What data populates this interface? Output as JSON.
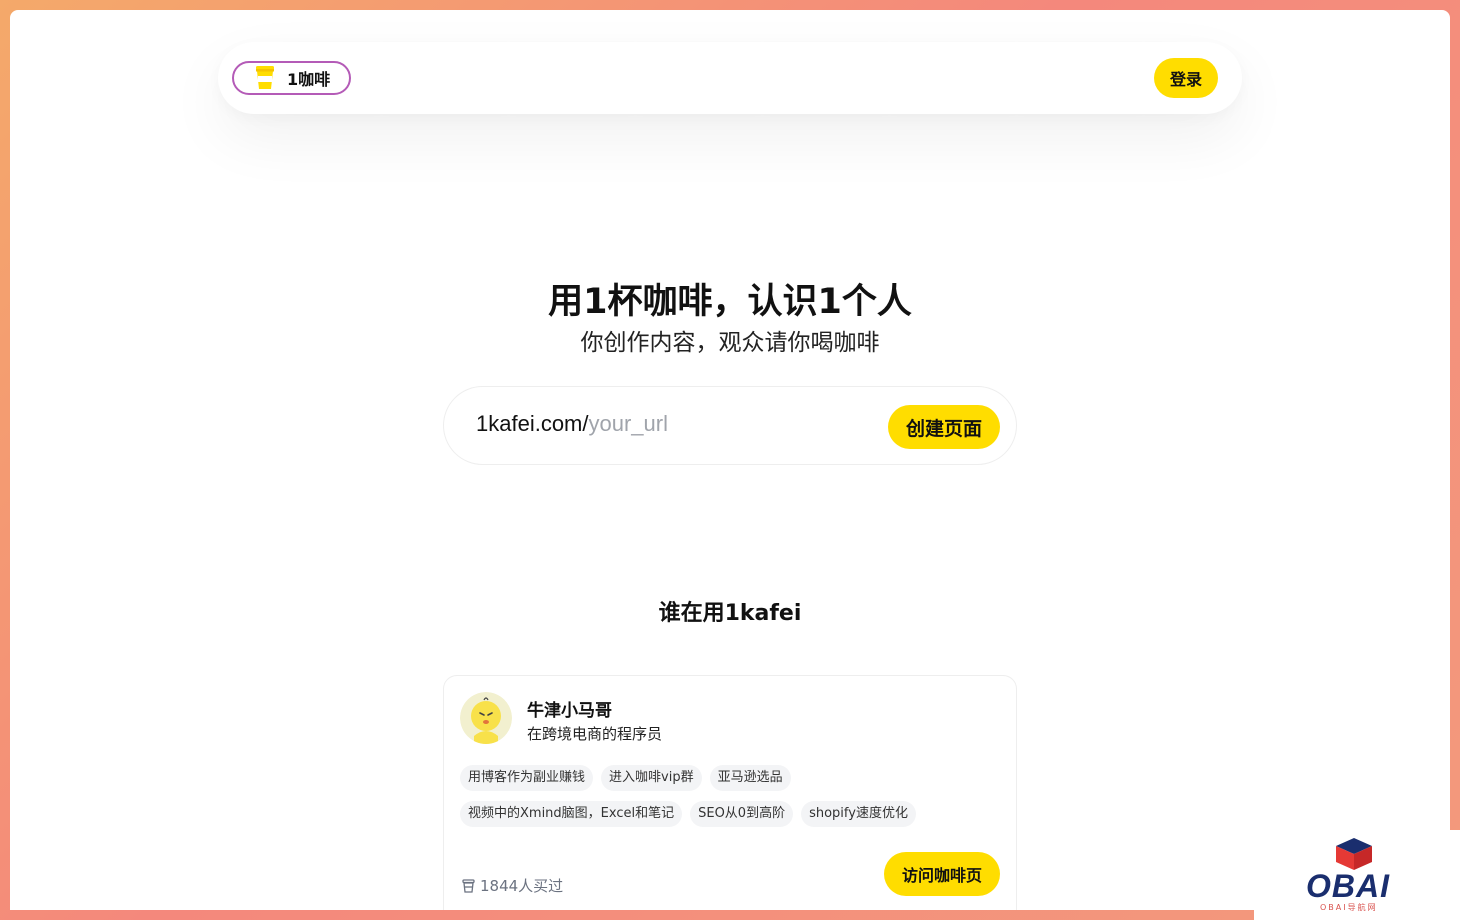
{
  "navbar": {
    "logo_text": "1咖啡",
    "logo_icon": "coffee-cup-icon",
    "login_label": "登录"
  },
  "hero": {
    "title": "用1杯咖啡，认识1个人",
    "subtitle": "你创作内容，观众请你喝咖啡"
  },
  "url_input": {
    "prefix": "1kafei.com/",
    "placeholder": "your_url",
    "button_label": "创建页面"
  },
  "section": {
    "title": "谁在用1kafei"
  },
  "card": {
    "name": "牛津小马哥",
    "bio": "在跨境电商的程序员",
    "tags": [
      "用博客作为副业赚钱",
      "进入咖啡vip群",
      "亚马逊选品",
      "视频中的Xmind脑图，Excel和笔记",
      "SEO从0到高阶",
      "shopify速度优化"
    ],
    "sold_text": "1844人买过",
    "visit_label": "访问咖啡页"
  },
  "watermark": {
    "text": "OBAI",
    "subtext": "OBAI导航网"
  },
  "colors": {
    "accent_yellow": "#ffdd00",
    "logo_border": "#b45bb7",
    "tag_bg": "#f3f4f6",
    "muted_text": "#6b7280"
  }
}
